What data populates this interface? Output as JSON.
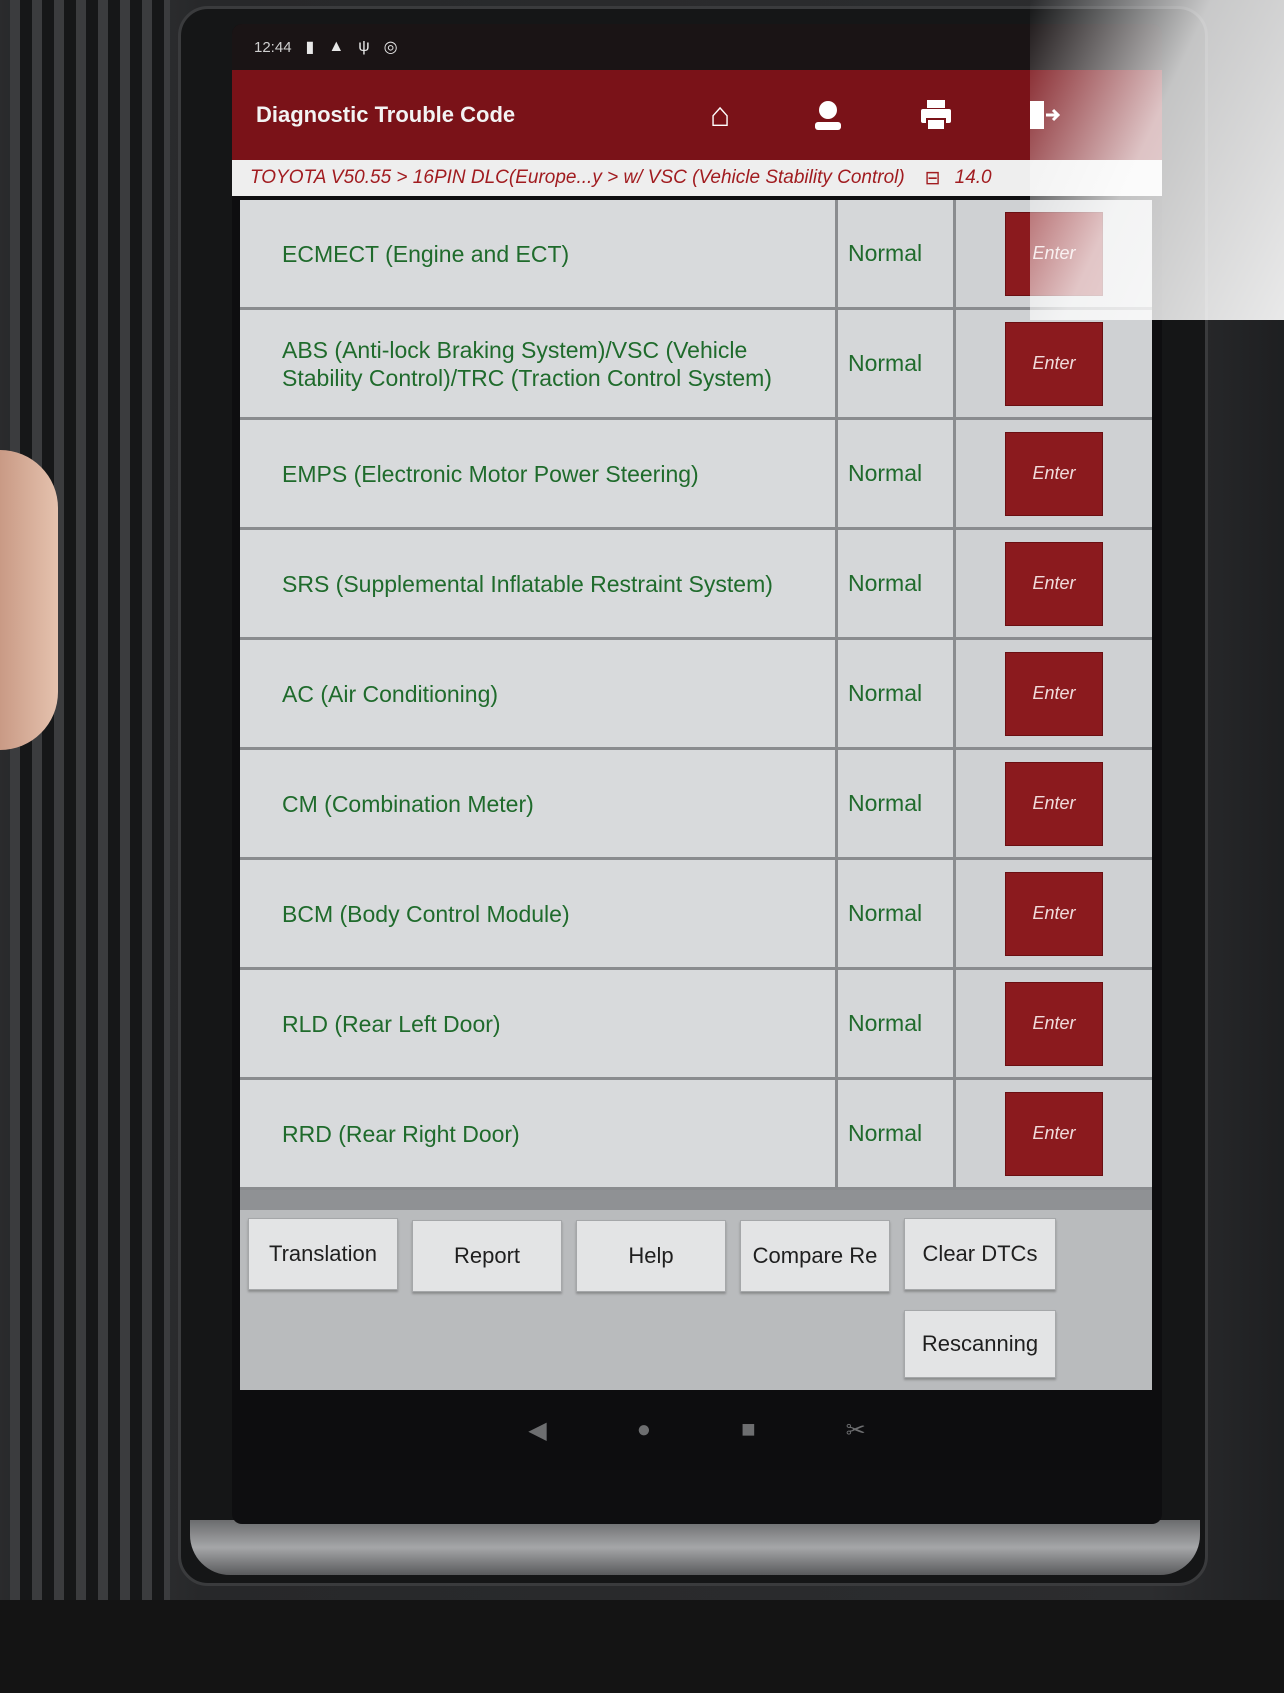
{
  "statusbar": {
    "time": "12:44",
    "icons": [
      "signal-icon",
      "warning-icon",
      "usb-icon",
      "vci-icon"
    ]
  },
  "appbar": {
    "title": "Diagnostic Trouble Code",
    "tools": [
      "home-icon",
      "user-icon",
      "printer-icon",
      "exit-icon"
    ]
  },
  "breadcrumb": {
    "path": "TOYOTA V50.55 > 16PIN DLC(Europe...y > w/ VSC (Vehicle Stability Control)",
    "battery_icon": "battery-icon",
    "voltage": "14.0"
  },
  "systems": [
    {
      "name": "ECMECT (Engine and ECT)",
      "status": "Normal",
      "action": "Enter"
    },
    {
      "name": "ABS (Anti-lock Braking System)/VSC (Vehicle Stability Control)/TRC (Traction Control System)",
      "status": "Normal",
      "action": "Enter"
    },
    {
      "name": "EMPS (Electronic Motor Power Steering)",
      "status": "Normal",
      "action": "Enter"
    },
    {
      "name": "SRS (Supplemental Inflatable Restraint System)",
      "status": "Normal",
      "action": "Enter"
    },
    {
      "name": "AC (Air Conditioning)",
      "status": "Normal",
      "action": "Enter"
    },
    {
      "name": "CM (Combination Meter)",
      "status": "Normal",
      "action": "Enter"
    },
    {
      "name": "BCM (Body Control Module)",
      "status": "Normal",
      "action": "Enter"
    },
    {
      "name": "RLD (Rear Left Door)",
      "status": "Normal",
      "action": "Enter"
    },
    {
      "name": "RRD (Rear Right Door)",
      "status": "Normal",
      "action": "Enter"
    }
  ],
  "footer": {
    "translation": "Translation",
    "report": "Report",
    "help": "Help",
    "compare": "Compare Re",
    "clear_dtcs": "Clear DTCs",
    "rescanning": "Rescanning"
  },
  "navbar": [
    "back-icon",
    "home-nav-icon",
    "recents-icon",
    "screenshot-icon"
  ],
  "colors": {
    "appbar": "#7a1218",
    "enter_button": "#8b1a1e",
    "status_text": "#1f6b2c",
    "breadcrumb_text": "#a11c20"
  }
}
